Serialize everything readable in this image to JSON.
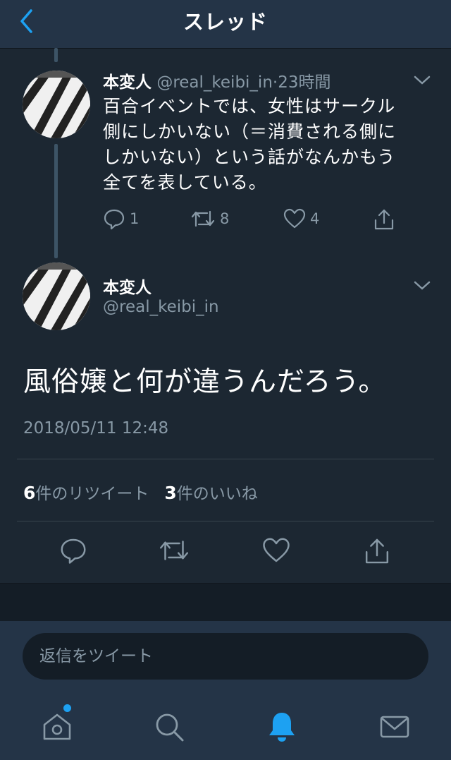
{
  "header": {
    "title": "スレッド"
  },
  "tweet1": {
    "name": "本変人",
    "handle": "@real_keibi_in",
    "sep": "·",
    "time": "23時間",
    "lines": [
      "百合イベントでは、女性はサークル",
      "側にしかいない（＝消費される側に",
      "しかいない）という話がなんかもう",
      "全てを表している。"
    ],
    "replies": "1",
    "retweets": "8",
    "likes": "4"
  },
  "tweet2": {
    "name": "本変人",
    "handle": "@real_keibi_in",
    "text": "風俗嬢と何が違うんだろう。",
    "timestamp": "2018/05/11 12:48",
    "retweet_count": "6",
    "retweet_label": "件のリツイート",
    "like_count": "3",
    "like_label": "件のいいね"
  },
  "reply": {
    "placeholder": "返信をツイート"
  },
  "icons": {
    "back": "chevron-left-icon",
    "reply": "speech-bubble-icon",
    "retweet": "retweet-icon",
    "like": "heart-icon",
    "share": "share-icon",
    "home": "home-icon",
    "search": "search-icon",
    "notifications": "bell-icon",
    "messages": "envelope-icon"
  },
  "colors": {
    "background": "#1c2732",
    "bar": "#243447",
    "accent": "#1da1f2",
    "muted": "#8899a6"
  }
}
